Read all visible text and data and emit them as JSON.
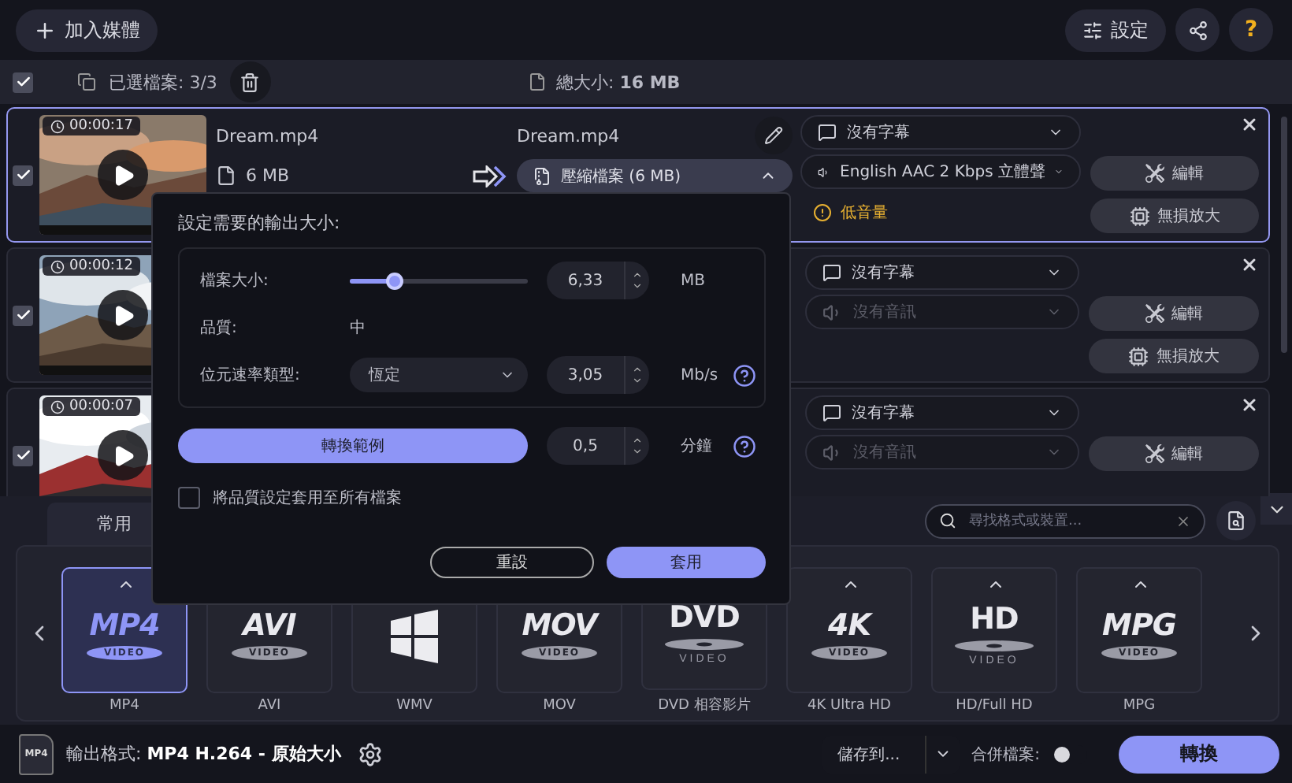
{
  "toolbar": {
    "add_button": "加入媒體",
    "settings_button": "設定",
    "help_button": "?"
  },
  "selection_bar": {
    "all_checked": true,
    "selected_label": "已選檔案: 3/3",
    "total": "總大小: **16 MB**"
  },
  "files": [
    {
      "checked": true,
      "selected": true,
      "duration": "00:00:17",
      "source_name": "Dream.mp4",
      "source_size": "6 MB",
      "output_name": "Dream.mp4",
      "output_size": {
        "label": "壓縮檔案 (6 MB)",
        "expanded": true
      },
      "subtitle": "沒有字幕",
      "audio": {
        "label": "English AAC 2 Kbps 立體聲",
        "disabled": false
      },
      "warning": "低音量",
      "buttons": [
        {
          "kind": "edit",
          "label": "編輯"
        },
        {
          "kind": "upscale",
          "label": "無損放大"
        }
      ]
    },
    {
      "checked": true,
      "selected": false,
      "duration": "00:00:12",
      "subtitle": "沒有字幕",
      "audio": {
        "label": "沒有音訊",
        "disabled": true
      },
      "buttons": [
        {
          "kind": "edit",
          "label": "編輯"
        },
        {
          "kind": "upscale",
          "label": "無損放大"
        }
      ]
    },
    {
      "checked": true,
      "selected": false,
      "duration": "00:00:07",
      "subtitle": "沒有字幕",
      "audio": {
        "label": "沒有音訊",
        "disabled": true
      },
      "buttons": [
        {
          "kind": "edit",
          "label": "編輯"
        }
      ]
    }
  ],
  "size_popup": {
    "title": "設定需要的輸出大小:",
    "file_size": {
      "label": "檔案大小:",
      "level": 0.25,
      "value": "6,33",
      "unit": "MB"
    },
    "quality": {
      "label": "品質:",
      "value": "中"
    },
    "bitrate": {
      "label": "位元速率類型:",
      "mode": "恆定",
      "value": "3,05",
      "unit": "Mb/s"
    },
    "preview": {
      "button": "轉換範例",
      "value": "0,5",
      "unit": "分鐘"
    },
    "apply_all": {
      "label": "將品質設定套用至所有檔案",
      "checked": false
    },
    "buttons": [
      {
        "kind": "secondary",
        "label": "重設"
      },
      {
        "kind": "primary",
        "label": "套用"
      }
    ]
  },
  "format_panel": {
    "tabs": [
      {
        "label": "常用",
        "selected": true
      }
    ],
    "search": {
      "placeholder": "尋找格式或裝置..."
    },
    "formats": [
      {
        "kind": "badge",
        "logo": "MP4",
        "sub": "VIDEO",
        "label": "MP4",
        "selected": true,
        "caret": true
      },
      {
        "kind": "badge",
        "logo": "AVI",
        "sub": "VIDEO",
        "label": "AVI",
        "selected": false
      },
      {
        "kind": "windows",
        "label": "WMV",
        "selected": false
      },
      {
        "kind": "badge",
        "logo": "MOV",
        "sub": "VIDEO",
        "label": "MOV",
        "selected": false
      },
      {
        "kind": "disc",
        "logo": "DVD",
        "sub": "VIDEO",
        "label": "DVD 相容影片",
        "selected": false
      },
      {
        "kind": "badge",
        "logo": "4K",
        "sub": "VIDEO",
        "label": "4K Ultra HD",
        "selected": false,
        "caret": true
      },
      {
        "kind": "disc",
        "logo": "HD",
        "sub": "VIDEO",
        "label": "HD/Full HD",
        "selected": false,
        "caret": true
      },
      {
        "kind": "badge",
        "logo": "MPG",
        "sub": "VIDEO",
        "label": "MPG",
        "selected": false,
        "caret": true
      }
    ]
  },
  "footer": {
    "format_badge": "MP4",
    "output": "輸出格式: **MP4 H.264 - 原始大小**",
    "save_button": "儲存到...",
    "merge": {
      "label": "合併檔案:",
      "on": false
    },
    "convert_button": "轉換"
  }
}
